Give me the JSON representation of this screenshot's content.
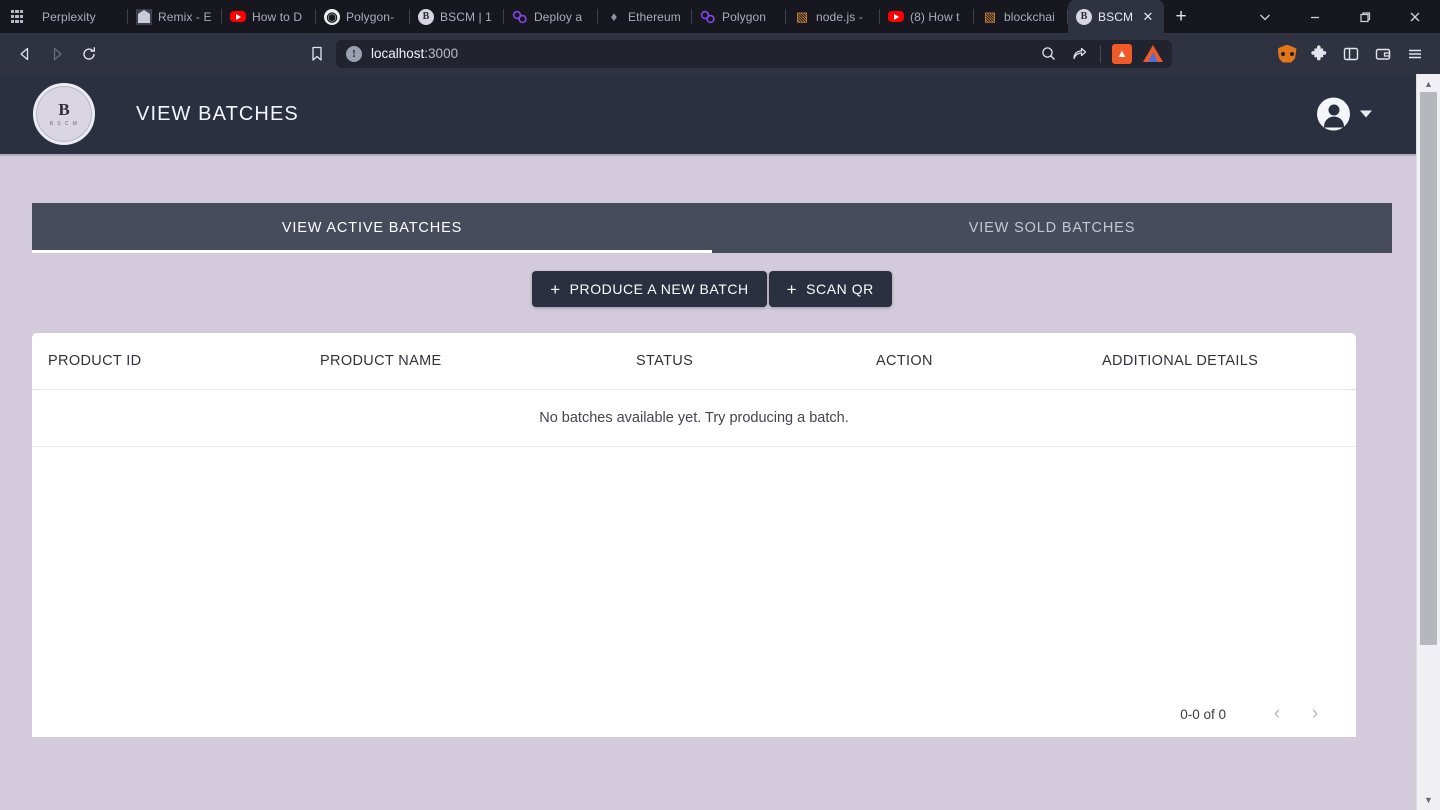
{
  "browser": {
    "tabs": [
      {
        "title": "Perplexity",
        "icon": "grid-icon",
        "active": false
      },
      {
        "title": "Remix - E",
        "icon": "remix-icon",
        "active": false
      },
      {
        "title": "How to D",
        "icon": "youtube-icon",
        "active": false
      },
      {
        "title": "Polygon-",
        "icon": "github-icon",
        "active": false
      },
      {
        "title": "BSCM | 1",
        "icon": "bscm-icon",
        "active": false
      },
      {
        "title": "Deploy a",
        "icon": "polygon-icon",
        "active": false
      },
      {
        "title": "Ethereum",
        "icon": "ethereum-icon",
        "active": false
      },
      {
        "title": "Polygon",
        "icon": "polygon-icon",
        "active": false
      },
      {
        "title": "node.js -",
        "icon": "nodejs-icon",
        "active": false
      },
      {
        "title": "(8) How t",
        "icon": "youtube-icon",
        "active": false
      },
      {
        "title": "blockchai",
        "icon": "nodejs-icon",
        "active": false
      },
      {
        "title": "BSCM",
        "icon": "bscm-icon",
        "active": true
      }
    ],
    "new_tab_label": "+",
    "window_controls": {
      "tab_search": "⌄",
      "minimize": "—",
      "restore": "❐",
      "close": "✕"
    },
    "nav": {
      "back": "◁",
      "forward": "▷",
      "reload": "⟳",
      "bookmark": "☐"
    },
    "url": {
      "warning_glyph": "!",
      "host": "localhost",
      "port": ":3000",
      "full": "localhost:3000"
    },
    "url_actions": {
      "zoom_search": "⌕",
      "share": "⤴",
      "brave_shields": "🦁",
      "brave_rewards": "▲"
    },
    "toolbar_right": {
      "metamask": "metamask-icon",
      "extensions": "❖",
      "sidebar": "▣",
      "wallet": "▤",
      "menu": "☰"
    }
  },
  "app": {
    "logo": {
      "mark": "B",
      "sub": "B S C M"
    },
    "title": "VIEW BATCHES",
    "account": {
      "icon": "account-circle-icon",
      "caret": "▾"
    },
    "tabs": [
      {
        "label": "VIEW ACTIVE BATCHES",
        "active": true
      },
      {
        "label": "VIEW SOLD BATCHES",
        "active": false
      }
    ],
    "actions": [
      {
        "label": "PRODUCE A NEW BATCH",
        "icon": "plus-icon"
      },
      {
        "label": "SCAN QR",
        "icon": "plus-icon"
      }
    ],
    "table": {
      "columns": [
        "PRODUCT ID",
        "PRODUCT NAME",
        "STATUS",
        "ACTION",
        "ADDITIONAL DETAILS"
      ],
      "rows": [],
      "empty_message": "No batches available yet. Try producing a batch."
    },
    "pagination": {
      "range_label": "0-0 of 0",
      "prev": "‹",
      "next": "›"
    }
  },
  "colors": {
    "chrome_dark": "#17171f",
    "toolbar": "#2f3241",
    "app_header": "#2b3040",
    "page_bg": "#d3cbdb",
    "content_bg": "#bbb2c4",
    "tabbar": "#474c5c",
    "accent_white": "#ffffff",
    "button": "#2b3040"
  }
}
